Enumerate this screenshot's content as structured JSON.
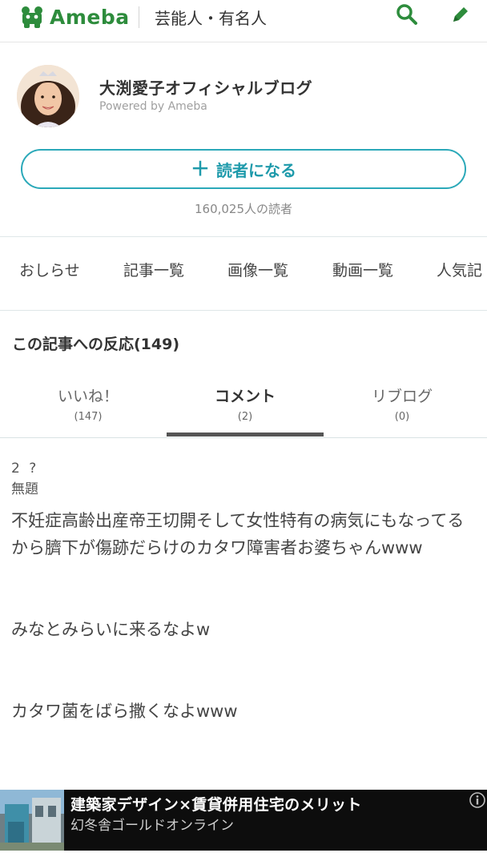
{
  "header": {
    "logo_text": "Ameba",
    "category": "芸能人・有名人",
    "icons": {
      "search": "search-icon",
      "edit": "pencil-icon",
      "logo": "ameba-mascot-icon"
    },
    "brand_color": "#2d8c3c"
  },
  "profile": {
    "blog_title": "大渕愛子オフィシャルブログ",
    "powered_by": "Powered by Ameba",
    "follow_label": "読者になる",
    "follow_icon": "plus-icon",
    "readers": "160,025人の読者",
    "accent_color": "#2ba9b9"
  },
  "nav": {
    "items": [
      "おしらせ",
      "記事一覧",
      "画像一覧",
      "動画一覧",
      "人気記"
    ]
  },
  "reactions": {
    "heading": "この記事への反応(149)",
    "tabs": [
      {
        "label": "いいね！",
        "count": "(147)"
      },
      {
        "label": "コメント",
        "count": "(2)"
      },
      {
        "label": "リブログ",
        "count": "(0)"
      }
    ],
    "active_tab": "コメント"
  },
  "comment": {
    "author": "2 ?",
    "title": "無題",
    "paragraphs": [
      "不妊症高齢出産帝王切開そして女性特有の病気にもなってるから臍下が傷跡だらけのカタワ障害者お婆ちゃんwww",
      "みなとみらいに来るなよw",
      "カタワ菌をばら撒くなよwww"
    ]
  },
  "ad": {
    "title": "建築家デザイン×賃貸併用住宅のメリット",
    "source": "幻冬舎ゴールドオンライン",
    "info_icon": "info-icon"
  }
}
